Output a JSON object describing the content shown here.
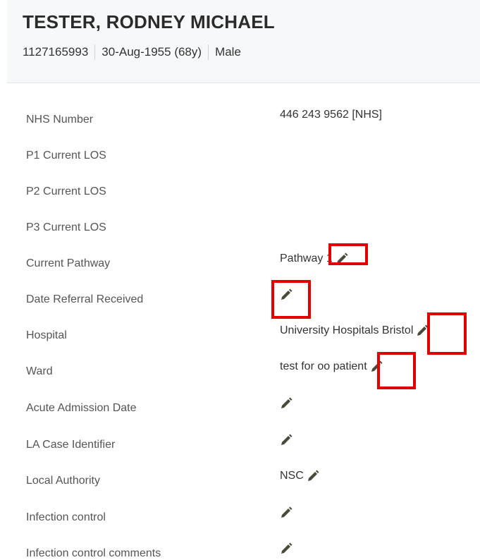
{
  "header": {
    "patient_name": "TESTER, RODNEY MICHAEL",
    "patient_id": "1127165993",
    "dob_age": "30-Aug-1955 (68y)",
    "sex": "Male"
  },
  "fields": [
    {
      "label": "NHS Number",
      "value": "446 243 9562 [NHS]",
      "editable": false
    },
    {
      "label": "P1 Current LOS",
      "value": "",
      "editable": false
    },
    {
      "label": "P2 Current LOS",
      "value": "",
      "editable": false
    },
    {
      "label": "P3 Current LOS",
      "value": "",
      "editable": false
    },
    {
      "label": "Current Pathway",
      "value": "Pathway 1",
      "editable": true
    },
    {
      "label": "Date Referral Received",
      "value": "",
      "editable": true
    },
    {
      "label": "Hospital",
      "value": "University Hospitals Bristol",
      "editable": true
    },
    {
      "label": "Ward",
      "value": "test for oo patient",
      "editable": true
    },
    {
      "label": "Acute Admission Date",
      "value": "",
      "editable": true
    },
    {
      "label": "LA Case Identifier",
      "value": "",
      "editable": true
    },
    {
      "label": "Local Authority",
      "value": "NSC",
      "editable": true
    },
    {
      "label": "Infection control",
      "value": "",
      "editable": true
    },
    {
      "label": "Infection control comments",
      "value": "",
      "editable": true
    }
  ],
  "colors": {
    "highlight": "#e00000",
    "pencil": "#4a4a3a",
    "header_bg": "#f7f8fa"
  },
  "icons": {
    "edit": "pencil-icon"
  }
}
